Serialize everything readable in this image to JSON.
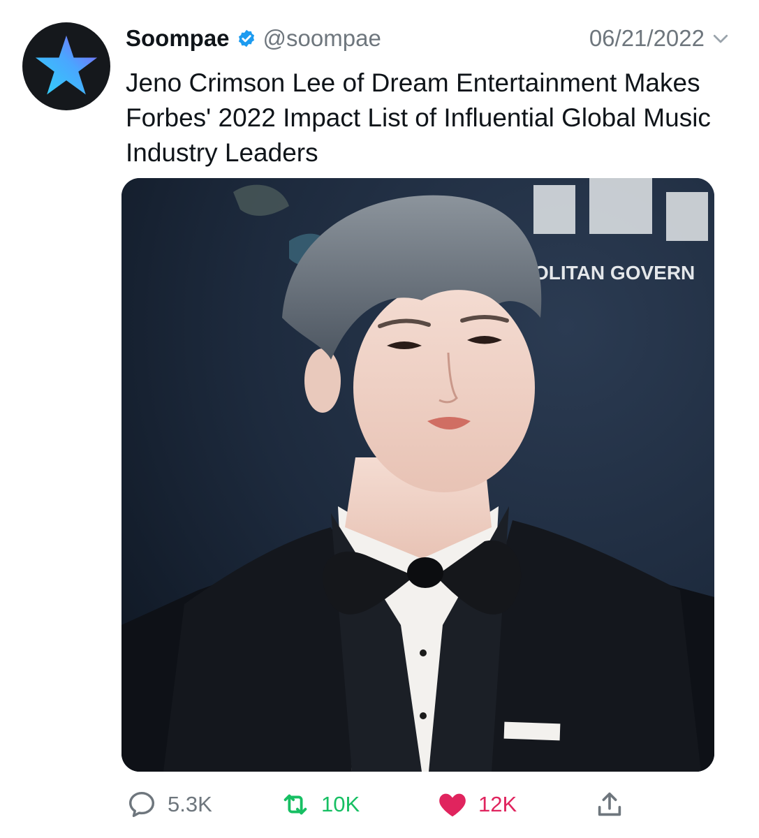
{
  "tweet": {
    "display_name": "Soompae",
    "handle": "@soompae",
    "date": "06/21/2022",
    "text": "Jeno Crimson Lee of Dream Entertainment Makes Forbes' 2022 Impact List of Influential Global Music Industry Leaders",
    "verified": true,
    "avatar_icon": "star-icon"
  },
  "media": {
    "backdrop_text": "OLITAN GOVERN"
  },
  "actions": {
    "replies": "5.3K",
    "retweets": "10K",
    "likes": "12K",
    "liked": true
  },
  "colors": {
    "verified_blue": "#1d9bf0",
    "secondary_text": "#6e767d",
    "retweet_green": "#17bf63",
    "like_red": "#e0245e",
    "avatar_bg": "#15181c"
  },
  "icons": {
    "verified": "verified-badge-icon",
    "caret": "chevron-down-icon",
    "reply": "reply-bubble-icon",
    "retweet": "retweet-icon",
    "like": "heart-icon",
    "share": "share-icon"
  }
}
